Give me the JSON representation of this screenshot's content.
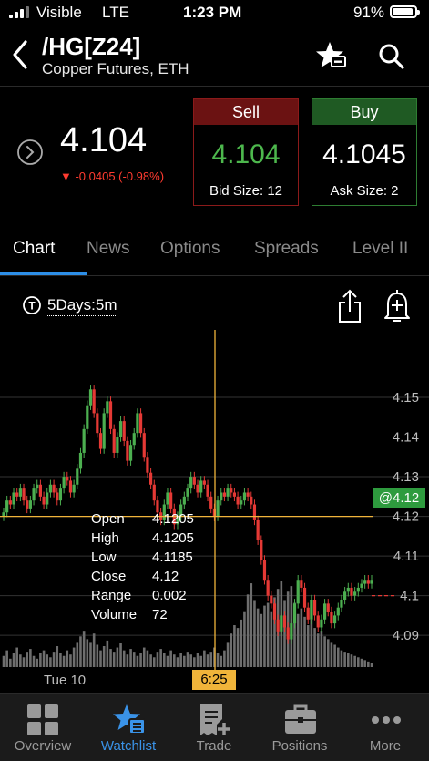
{
  "status_bar": {
    "carrier": "Visible",
    "network": "LTE",
    "time": "1:23 PM",
    "battery": "91%",
    "battery_level": 0.91
  },
  "header": {
    "symbol": "/HG[Z24]",
    "description": "Copper Futures, ETH"
  },
  "quote": {
    "last": "4.104",
    "change": "▼ -0.0405 (-0.98%)",
    "sell": {
      "label": "Sell",
      "price": "4.104",
      "size_label": "Bid Size: 12",
      "color": "#4db84d"
    },
    "buy": {
      "label": "Buy",
      "price": "4.1045",
      "size_label": "Ask Size: 2"
    }
  },
  "tabs": [
    {
      "label": "Chart",
      "active": true
    },
    {
      "label": "News"
    },
    {
      "label": "Options"
    },
    {
      "label": "Spreads"
    },
    {
      "label": "Level II"
    }
  ],
  "chart_toolbar": {
    "period": "5Days:5m"
  },
  "chart_data": {
    "type": "candlestick",
    "y_ticks": [
      "4.15",
      "4.14",
      "4.13",
      "4.12",
      "4.11",
      "4.1",
      "4.09"
    ],
    "ylim": [
      4.082,
      4.167
    ],
    "x_labels": [
      "Tue 10"
    ],
    "crosshair": {
      "time": "6:25",
      "price": "@4.12"
    },
    "ohlc_readout": [
      {
        "label": "Open",
        "value": "4.1205"
      },
      {
        "label": "High",
        "value": "4.1205"
      },
      {
        "label": "Low",
        "value": "4.1185"
      },
      {
        "label": "Close",
        "value": "4.12"
      },
      {
        "label": "Range",
        "value": "0.002"
      },
      {
        "label": "Volume",
        "value": "72"
      }
    ],
    "last_price_line": 4.1,
    "close_series": [
      4.121,
      4.124,
      4.123,
      4.126,
      4.125,
      4.127,
      4.124,
      4.122,
      4.124,
      4.127,
      4.128,
      4.125,
      4.123,
      4.126,
      4.128,
      4.126,
      4.124,
      4.127,
      4.13,
      4.129,
      4.126,
      4.128,
      4.132,
      4.136,
      4.142,
      4.148,
      4.152,
      4.146,
      4.141,
      4.137,
      4.146,
      4.149,
      4.142,
      4.136,
      4.14,
      4.144,
      4.139,
      4.134,
      4.138,
      4.141,
      4.146,
      4.141,
      4.135,
      4.131,
      4.128,
      4.124,
      4.121,
      4.119,
      4.123,
      4.126,
      4.122,
      4.118,
      4.12,
      4.123,
      4.125,
      4.127,
      4.13,
      4.128,
      4.126,
      4.129,
      4.128,
      4.125,
      4.122,
      4.12,
      4.124,
      4.126,
      4.125,
      4.127,
      4.126,
      4.125,
      4.123,
      4.124,
      4.126,
      4.125,
      4.123,
      4.119,
      4.114,
      4.109,
      4.104,
      4.1,
      4.098,
      4.094,
      4.091,
      4.095,
      4.092,
      4.089,
      4.093,
      4.098,
      4.104,
      4.102,
      4.097,
      4.094,
      4.099,
      4.095,
      4.092,
      4.094,
      4.098,
      4.096,
      4.093,
      4.095,
      4.097,
      4.099,
      4.101,
      4.102,
      4.1,
      4.101,
      4.102,
      4.103,
      4.104,
      4.103,
      4.104
    ],
    "volume_series": [
      8,
      12,
      6,
      10,
      14,
      9,
      7,
      11,
      13,
      8,
      6,
      10,
      12,
      9,
      7,
      11,
      15,
      10,
      8,
      12,
      9,
      14,
      18,
      22,
      26,
      20,
      18,
      24,
      16,
      12,
      15,
      19,
      13,
      11,
      14,
      17,
      12,
      9,
      13,
      11,
      8,
      10,
      14,
      12,
      9,
      7,
      11,
      13,
      10,
      8,
      12,
      9,
      7,
      10,
      8,
      11,
      9,
      7,
      10,
      8,
      12,
      9,
      11,
      14,
      10,
      8,
      12,
      18,
      24,
      30,
      28,
      34,
      40,
      52,
      60,
      48,
      42,
      38,
      44,
      46,
      40,
      50,
      56,
      62,
      48,
      54,
      58,
      46,
      38,
      42,
      36,
      30,
      34,
      28,
      24,
      26,
      22,
      20,
      18,
      16,
      14,
      12,
      11,
      10,
      9,
      8,
      7,
      6,
      5,
      4,
      3
    ]
  },
  "tab_bar": [
    {
      "label": "Overview",
      "icon": "overview-icon"
    },
    {
      "label": "Watchlist",
      "icon": "watchlist-icon",
      "active": true
    },
    {
      "label": "Trade",
      "icon": "trade-icon"
    },
    {
      "label": "Positions",
      "icon": "positions-icon"
    },
    {
      "label": "More",
      "icon": "more-icon"
    }
  ],
  "colors": {
    "accent": "#2d8ee6",
    "up": "#4caf50",
    "down": "#e53935",
    "crosshair": "#f0b43a",
    "sell_border": "#8b1a1a",
    "buy_border": "#2e7d32"
  }
}
